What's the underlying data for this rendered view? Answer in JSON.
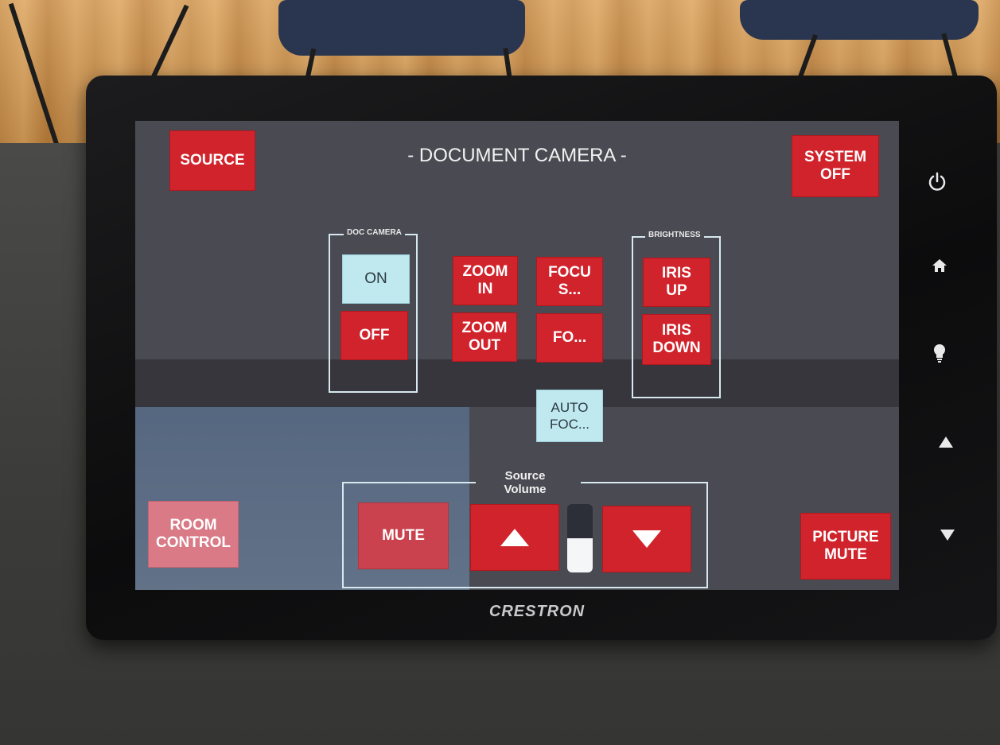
{
  "screen": {
    "title": "- DOCUMENT CAMERA -"
  },
  "buttons": {
    "source": "SOURCE",
    "system_off": [
      "SYSTEM",
      "OFF"
    ],
    "room_control": [
      "ROOM",
      "CONTROL"
    ],
    "picture_mute": [
      "PICTURE",
      "MUTE"
    ]
  },
  "doc_camera": {
    "label": "DOC CAMERA",
    "on": "ON",
    "off": "OFF"
  },
  "lens_controls": {
    "zoom_in": [
      "ZOOM",
      "IN"
    ],
    "zoom_out": [
      "ZOOM",
      "OUT"
    ],
    "focus_near": [
      "FOCU",
      "S..."
    ],
    "focus_far": "FO...",
    "auto_focus": [
      "AUTO",
      "FOC..."
    ]
  },
  "brightness": {
    "label": "BRIGHTNESS",
    "iris_up": [
      "IRIS",
      "UP"
    ],
    "iris_down": [
      "IRIS",
      "DOWN"
    ]
  },
  "volume": {
    "label": [
      "Source",
      "Volume"
    ],
    "mute": "MUTE",
    "level": 0.5
  },
  "device": {
    "brand": "CRESTRON",
    "side_buttons": [
      "power-icon",
      "home-icon",
      "lightbulb-icon",
      "arrow-up-icon",
      "arrow-down-icon"
    ]
  },
  "colors": {
    "button_red": "#d1232b",
    "button_pale": "#d97a86",
    "button_light": "#bfe8ef"
  }
}
